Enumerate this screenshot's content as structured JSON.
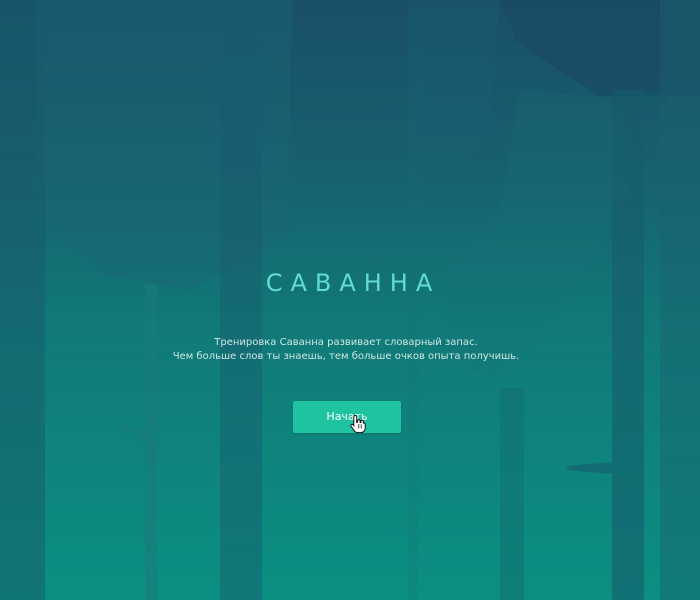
{
  "screen": {
    "title": "САВАННА",
    "description_lines": [
      "Тренировка Саванна развивает словарный запас.",
      "Чем больше слов ты знаешь, тем больше очков опыта получишь."
    ],
    "start_button_label": "Начать"
  },
  "colors": {
    "background_top": "#1a4f68",
    "background_bottom": "#0b8f81",
    "title": "#63dcd0",
    "button": "#1fc3a0",
    "button_text": "#ffffff",
    "description_text": "#cfe7e4"
  },
  "icons": {
    "cursor": "hand-pointer-icon"
  }
}
